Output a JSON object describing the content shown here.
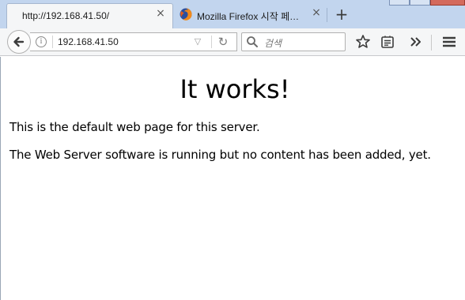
{
  "browser": {
    "tabs": [
      {
        "title": "http://192.168.41.50/",
        "active": true
      },
      {
        "title": "Mozilla Firefox 시작 페…",
        "active": false,
        "icon": "firefox-logo-icon"
      }
    ],
    "new_tab_symbol": "+",
    "close_symbol": "×",
    "url": "192.168.41.50",
    "search_placeholder": "검색",
    "toolbar_icons": [
      "back-arrow-icon",
      "info-icon",
      "dropmarker-icon",
      "reload-icon",
      "search-icon",
      "bookmark-star-icon",
      "reading-list-icon",
      "overflow-chevron-icon",
      "hamburger-menu-icon"
    ]
  },
  "page": {
    "heading": "It works!",
    "paragraphs": [
      "This is the default web page for this server.",
      "The Web Server software is running but no content has been added, yet."
    ]
  },
  "colors": {
    "tabstrip": "#c2d5ee",
    "toolbar": "#f5f6f7",
    "page_background": "#ffffff"
  }
}
